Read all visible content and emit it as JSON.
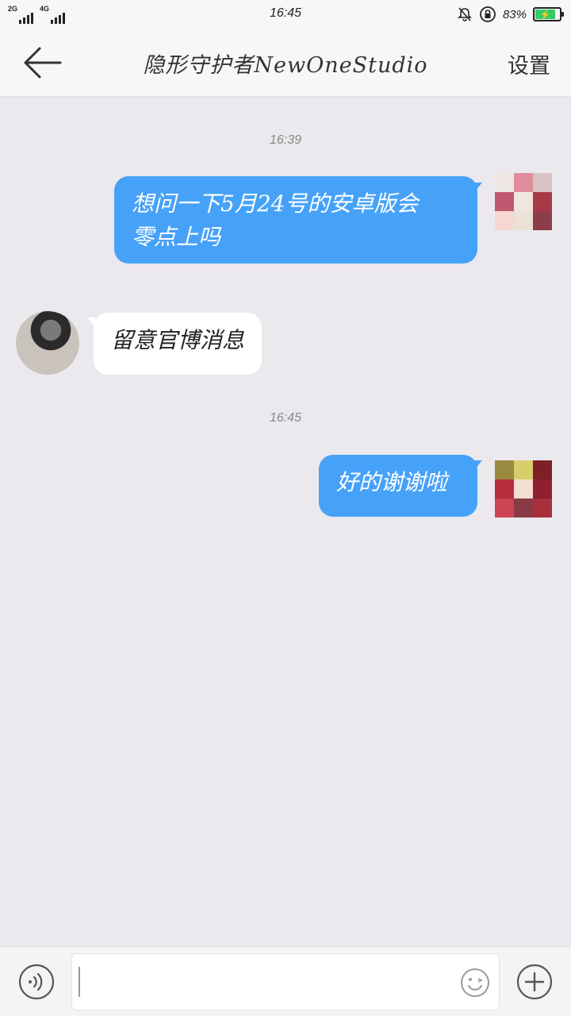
{
  "status_bar": {
    "net_left": "2G",
    "net_right": "4G",
    "time": "16:45",
    "battery": "83%"
  },
  "header": {
    "title": "隐形守护者NewOneStudio",
    "settings_label": "设置"
  },
  "messages": [
    {
      "timestamp": "16:39"
    },
    {
      "text_line1": "想问一下5月24号的安卓版会",
      "text_line2": "零点上吗"
    },
    {
      "text": "留意官博消息"
    },
    {
      "timestamp": "16:45"
    },
    {
      "text": "好的谢谢啦"
    }
  ],
  "colors": {
    "out_bubble": "#46a2f8",
    "in_bubble": "#ffffff",
    "background": "#ebe9ed"
  },
  "icons": {
    "back": "arrow-left-icon",
    "voice": "voice-icon",
    "emoji": "emoji-icon",
    "plus": "plus-icon"
  }
}
